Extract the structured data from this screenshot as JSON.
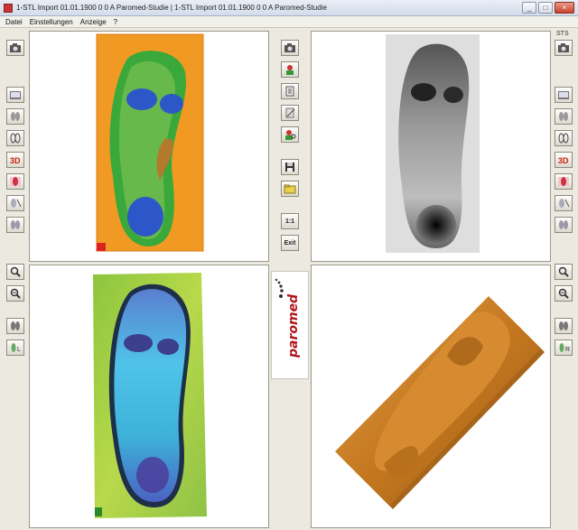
{
  "window": {
    "title": "1-STL Import 01.01.1900 0 0 A Paromed-Studie  |  1-STL Import 01.01.1900 0 0 A Paromed-Studie",
    "buttons": {
      "minimize": "_",
      "maximize": "□",
      "close": "×"
    }
  },
  "menu": {
    "items": [
      "Datei",
      "Einstellungen",
      "Anzeige",
      "?"
    ]
  },
  "side_label": "STS",
  "middle_toolbar": {
    "scale_label": "1:1",
    "exit_label": "Exit"
  },
  "logo": {
    "text": "paromed"
  },
  "colors": {
    "brand": "#b0161b",
    "heatmap_base": "#f08c1e",
    "heatmap_mid": "#3aa83a",
    "heatmap_low": "#2850c8",
    "render_3d": "#c47a24"
  }
}
